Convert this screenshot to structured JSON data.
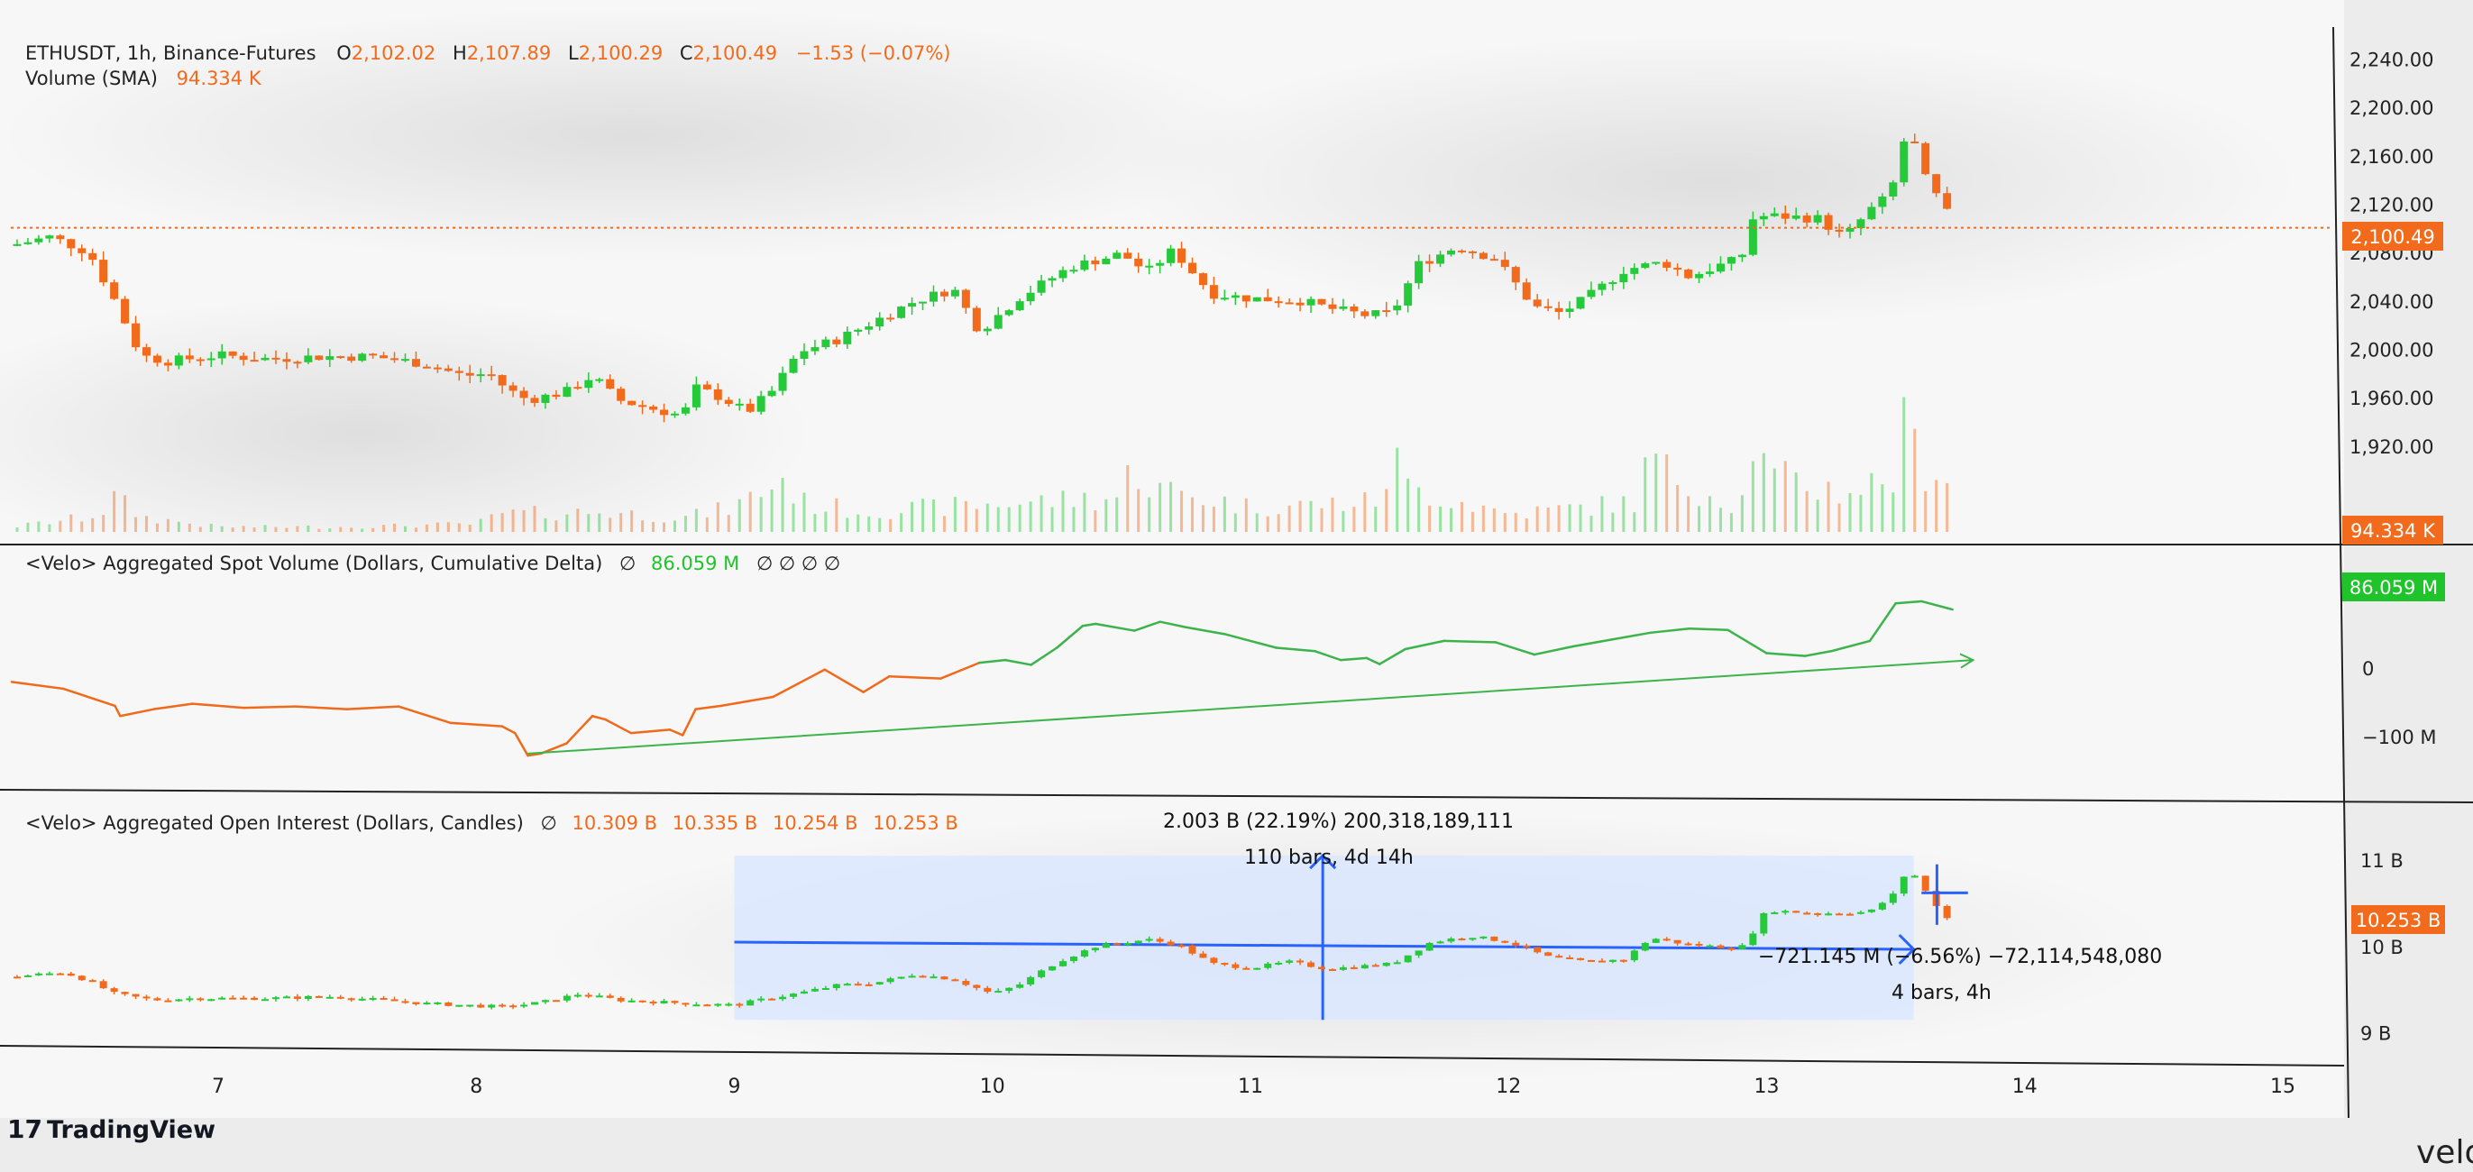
{
  "colors": {
    "up": "#26c93a",
    "down": "#f26a1b",
    "axis_text": "#222222",
    "cvd_up": "#3cb44b",
    "cvd_down": "#f06a1b",
    "measure": "#2962ff",
    "measure_fill": "#dbe7ff",
    "badge_green": "#1fc42a",
    "badge_orange": "#f26a1b"
  },
  "price_pane": {
    "legend_symbol": "ETHUSDT, 1h, Binance-Futures",
    "o_label": "O",
    "o_value": "2,102.02",
    "h_label": "H",
    "h_value": "2,107.89",
    "l_label": "L",
    "l_value": "2,100.29",
    "c_label": "C",
    "c_value": "2,100.49",
    "change": "−1.53 (−0.07%)",
    "volume_label": "Volume (SMA)",
    "volume_value": "94.334 K",
    "last_price_badge": "2,100.49",
    "volume_badge": "94.334 K"
  },
  "cvd_pane": {
    "legend": "<Velo> Aggregated Spot Volume (Dollars, Cumulative Delta)",
    "legend_sym": "∅",
    "value": "86.059 M",
    "trailing": "∅  ∅  ∅  ∅",
    "badge": "86.059 M"
  },
  "oi_pane": {
    "legend": "<Velo> Aggregated Open Interest (Dollars, Candles)",
    "legend_sym": "∅",
    "values": [
      "10.309 B",
      "10.335 B",
      "10.254 B",
      "10.253 B"
    ],
    "badge": "10.253 B",
    "measure_top_text": "2.003 B (22.19%) 200,318,189,111",
    "measure_bars_text": "110 bars, 4d 14h",
    "measure2_text": "−721.145 M (−6.56%) −72,114,548,080",
    "measure2_bars_text": "4 bars, 4h"
  },
  "watermark": "TradingView",
  "watermark_right": "velo",
  "chart_data": [
    {
      "type": "candlestick",
      "title": "ETHUSDT, 1h, Binance-Futures",
      "ylim": [
        1890,
        2250
      ],
      "y_ticks": [
        {
          "v": 2240,
          "t": "2,240.00"
        },
        {
          "v": 2200,
          "t": "2,200.00"
        },
        {
          "v": 2160,
          "t": "2,160.00"
        },
        {
          "v": 2120,
          "t": "2,120.00"
        },
        {
          "v": 2080,
          "t": "2,080.00"
        },
        {
          "v": 2040,
          "t": "2,040.00"
        },
        {
          "v": 2000,
          "t": "2,000.00"
        },
        {
          "v": 1960,
          "t": "1,960.00"
        },
        {
          "v": 1920,
          "t": "1,920.00"
        }
      ],
      "x_ticks": [
        {
          "day": 7,
          "t": "7"
        },
        {
          "day": 8,
          "t": "8"
        },
        {
          "day": 9,
          "t": "9"
        },
        {
          "day": 10,
          "t": "10"
        },
        {
          "day": 11,
          "t": "11"
        },
        {
          "day": 12,
          "t": "12"
        },
        {
          "day": 13,
          "t": "13"
        },
        {
          "day": 14,
          "t": "14"
        },
        {
          "day": 15,
          "t": "15"
        }
      ],
      "x_start_day": 6.2,
      "last_price": 2100.49,
      "close_path": [
        [
          6.2,
          2086
        ],
        [
          6.35,
          2093
        ],
        [
          6.5,
          2080
        ],
        [
          6.6,
          2040
        ],
        [
          6.7,
          1995
        ],
        [
          6.8,
          1990
        ],
        [
          7.0,
          1995
        ],
        [
          7.2,
          1992
        ],
        [
          7.4,
          1994
        ],
        [
          7.6,
          1994
        ],
        [
          7.8,
          1988
        ],
        [
          7.95,
          1978
        ],
        [
          8.05,
          1980
        ],
        [
          8.12,
          1967
        ],
        [
          8.2,
          1958
        ],
        [
          8.35,
          1965
        ],
        [
          8.45,
          1978
        ],
        [
          8.55,
          1958
        ],
        [
          8.7,
          1950
        ],
        [
          8.8,
          1945
        ],
        [
          8.85,
          1968
        ],
        [
          8.95,
          1960
        ],
        [
          9.05,
          1948
        ],
        [
          9.15,
          1966
        ],
        [
          9.25,
          1998
        ],
        [
          9.4,
          2008
        ],
        [
          9.55,
          2024
        ],
        [
          9.7,
          2040
        ],
        [
          9.85,
          2050
        ],
        [
          9.95,
          2015
        ],
        [
          10.1,
          2042
        ],
        [
          10.3,
          2068
        ],
        [
          10.5,
          2079
        ],
        [
          10.6,
          2064
        ],
        [
          10.7,
          2082
        ],
        [
          10.85,
          2046
        ],
        [
          11.0,
          2042
        ],
        [
          11.2,
          2040
        ],
        [
          11.3,
          2034
        ],
        [
          11.45,
          2028
        ],
        [
          11.55,
          2030
        ],
        [
          11.65,
          2070
        ],
        [
          11.8,
          2085
        ],
        [
          11.95,
          2075
        ],
        [
          12.1,
          2035
        ],
        [
          12.2,
          2030
        ],
        [
          12.3,
          2042
        ],
        [
          12.45,
          2066
        ],
        [
          12.6,
          2072
        ],
        [
          12.7,
          2060
        ],
        [
          12.8,
          2068
        ],
        [
          12.9,
          2075
        ],
        [
          12.95,
          2110
        ],
        [
          13.05,
          2110
        ],
        [
          13.2,
          2108
        ],
        [
          13.3,
          2092
        ],
        [
          13.4,
          2115
        ],
        [
          13.48,
          2128
        ],
        [
          13.53,
          2172
        ],
        [
          13.58,
          2168
        ],
        [
          13.63,
          2130
        ],
        [
          13.68,
          2124
        ],
        [
          13.72,
          2100
        ]
      ],
      "volume_path": [
        [
          6.2,
          5
        ],
        [
          6.5,
          15
        ],
        [
          6.58,
          25
        ],
        [
          6.6,
          35
        ],
        [
          6.7,
          15
        ],
        [
          7.0,
          5
        ],
        [
          7.5,
          5
        ],
        [
          8.0,
          8
        ],
        [
          8.1,
          18
        ],
        [
          8.5,
          20
        ],
        [
          8.8,
          14
        ],
        [
          9.0,
          25
        ],
        [
          9.2,
          55
        ],
        [
          9.25,
          30
        ],
        [
          9.5,
          20
        ],
        [
          10.0,
          28
        ],
        [
          10.5,
          35
        ],
        [
          10.55,
          75
        ],
        [
          10.6,
          45
        ],
        [
          11.0,
          25
        ],
        [
          11.5,
          30
        ],
        [
          11.55,
          80
        ],
        [
          11.6,
          45
        ],
        [
          12.0,
          18
        ],
        [
          12.5,
          30
        ],
        [
          12.55,
          80
        ],
        [
          12.6,
          60
        ],
        [
          12.9,
          25
        ],
        [
          12.95,
          100
        ],
        [
          13.0,
          55
        ],
        [
          13.3,
          40
        ],
        [
          13.5,
          55
        ],
        [
          13.53,
          100
        ],
        [
          13.6,
          70
        ],
        [
          13.72,
          55
        ]
      ]
    },
    {
      "type": "line",
      "title": "<Velo> Aggregated Spot Volume (Dollars, Cumulative Delta)",
      "ylim": [
        -170,
        160
      ],
      "y_ticks": [
        {
          "v": 0,
          "t": "0"
        },
        {
          "v": -100,
          "t": "−100 M"
        }
      ],
      "path": [
        [
          6.2,
          -20
        ],
        [
          6.4,
          -30
        ],
        [
          6.6,
          -55
        ],
        [
          6.62,
          -70
        ],
        [
          6.75,
          -60
        ],
        [
          6.9,
          -52
        ],
        [
          7.1,
          -58
        ],
        [
          7.3,
          -56
        ],
        [
          7.5,
          -60
        ],
        [
          7.7,
          -56
        ],
        [
          7.9,
          -80
        ],
        [
          8.1,
          -85
        ],
        [
          8.15,
          -95
        ],
        [
          8.2,
          -128
        ],
        [
          8.25,
          -125
        ],
        [
          8.35,
          -110
        ],
        [
          8.45,
          -70
        ],
        [
          8.5,
          -75
        ],
        [
          8.6,
          -95
        ],
        [
          8.75,
          -90
        ],
        [
          8.8,
          -98
        ],
        [
          8.85,
          -60
        ],
        [
          8.95,
          -55
        ],
        [
          9.15,
          -42
        ],
        [
          9.3,
          -12
        ],
        [
          9.35,
          -2
        ],
        [
          9.5,
          -35
        ],
        [
          9.6,
          -12
        ],
        [
          9.8,
          -15
        ],
        [
          9.95,
          8
        ],
        [
          10.05,
          12
        ],
        [
          10.15,
          5
        ],
        [
          10.25,
          30
        ],
        [
          10.35,
          62
        ],
        [
          10.4,
          65
        ],
        [
          10.55,
          55
        ],
        [
          10.65,
          68
        ],
        [
          10.75,
          60
        ],
        [
          10.9,
          50
        ],
        [
          11.0,
          40
        ],
        [
          11.1,
          30
        ],
        [
          11.25,
          25
        ],
        [
          11.35,
          12
        ],
        [
          11.45,
          15
        ],
        [
          11.5,
          6
        ],
        [
          11.6,
          28
        ],
        [
          11.75,
          40
        ],
        [
          11.95,
          38
        ],
        [
          12.1,
          20
        ],
        [
          12.25,
          32
        ],
        [
          12.4,
          42
        ],
        [
          12.55,
          52
        ],
        [
          12.7,
          58
        ],
        [
          12.85,
          56
        ],
        [
          13.0,
          22
        ],
        [
          13.15,
          18
        ],
        [
          13.25,
          25
        ],
        [
          13.4,
          40
        ],
        [
          13.5,
          95
        ],
        [
          13.6,
          98
        ],
        [
          13.72,
          86
        ]
      ],
      "trend_line": [
        [
          8.2,
          -125
        ],
        [
          13.8,
          12
        ]
      ]
    },
    {
      "type": "candlestick",
      "title": "<Velo> Aggregated Open Interest (Dollars, Candles)",
      "ylim": [
        8.85,
        11.25
      ],
      "y_ticks": [
        {
          "v": 11,
          "t": "11 B"
        },
        {
          "v": 10,
          "t": "10 B"
        },
        {
          "v": 9,
          "t": "9 B"
        }
      ],
      "close_path": [
        [
          6.2,
          9.65
        ],
        [
          6.4,
          9.7
        ],
        [
          6.5,
          9.6
        ],
        [
          6.6,
          9.45
        ],
        [
          6.75,
          9.38
        ],
        [
          6.9,
          9.4
        ],
        [
          7.2,
          9.4
        ],
        [
          7.45,
          9.42
        ],
        [
          7.8,
          9.34
        ],
        [
          8.1,
          9.3
        ],
        [
          8.25,
          9.35
        ],
        [
          8.4,
          9.45
        ],
        [
          8.55,
          9.38
        ],
        [
          8.75,
          9.35
        ],
        [
          9.0,
          9.32
        ],
        [
          9.1,
          9.38
        ],
        [
          9.25,
          9.46
        ],
        [
          9.4,
          9.55
        ],
        [
          9.55,
          9.58
        ],
        [
          9.7,
          9.68
        ],
        [
          9.85,
          9.62
        ],
        [
          10.0,
          9.45
        ],
        [
          10.1,
          9.55
        ],
        [
          10.25,
          9.82
        ],
        [
          10.4,
          10.0
        ],
        [
          10.6,
          10.08
        ],
        [
          10.72,
          10.02
        ],
        [
          10.85,
          9.8
        ],
        [
          11.0,
          9.75
        ],
        [
          11.15,
          9.82
        ],
        [
          11.3,
          9.74
        ],
        [
          11.55,
          9.8
        ],
        [
          11.7,
          10.05
        ],
        [
          11.85,
          10.12
        ],
        [
          12.0,
          10.05
        ],
        [
          12.15,
          9.88
        ],
        [
          12.3,
          9.82
        ],
        [
          12.45,
          9.85
        ],
        [
          12.55,
          10.1
        ],
        [
          12.7,
          10.02
        ],
        [
          12.9,
          9.98
        ],
        [
          12.95,
          10.18
        ],
        [
          13.0,
          10.42
        ],
        [
          13.2,
          10.38
        ],
        [
          13.4,
          10.4
        ],
        [
          13.5,
          10.62
        ],
        [
          13.55,
          10.92
        ],
        [
          13.62,
          10.62
        ],
        [
          13.72,
          10.25
        ]
      ],
      "measure_box": {
        "x0": 9.0,
        "x1": 13.57,
        "y0": 9.15,
        "y1": 11.05
      },
      "measure_h": {
        "x0": 9.0,
        "x1": 13.57,
        "y": 10.05
      },
      "measure_v": {
        "x": 11.28,
        "y0": 9.15,
        "y1": 11.05
      },
      "measure2": {
        "x": 13.66,
        "y0": 10.25,
        "y1": 10.95,
        "xh0": 13.6,
        "xh1": 13.78,
        "yh": 10.62
      }
    }
  ]
}
